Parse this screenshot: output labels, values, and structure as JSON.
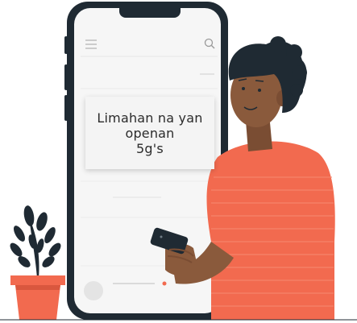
{
  "card": {
    "text": "Limahan na yan\nopenan\n5g's"
  },
  "icons": {
    "menu": "hamburger-menu-icon",
    "search": "search-icon"
  },
  "colors": {
    "phone_frame": "#1f2a33",
    "screen": "#f6f6f6",
    "shirt": "#f26a4f",
    "skin": "#8a5a3c",
    "hair": "#1f2a33",
    "pot": "#f26a4f",
    "leaves": "#1f2a33",
    "accent_dot": "#f26a4f"
  }
}
